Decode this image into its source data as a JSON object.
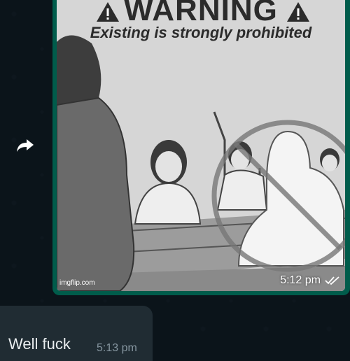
{
  "incoming_message": {
    "text": "Well fuck",
    "time": "5:13 pm"
  },
  "outgoing_image_message": {
    "meme": {
      "headline": "WARNING",
      "subline": "Existing is strongly prohibited",
      "watermark": "imgflip.com"
    },
    "time": "5:12 pm",
    "status_icon": "double-check-icon"
  },
  "icons": {
    "forward": "forward-icon",
    "warning": "warning-triangle-icon"
  },
  "colors": {
    "chat_background": "#0b141a",
    "outgoing_bubble": "#005c4b",
    "incoming_bubble": "#202c33",
    "primary_text": "#e9edef",
    "meta_text": "#8696a0"
  }
}
